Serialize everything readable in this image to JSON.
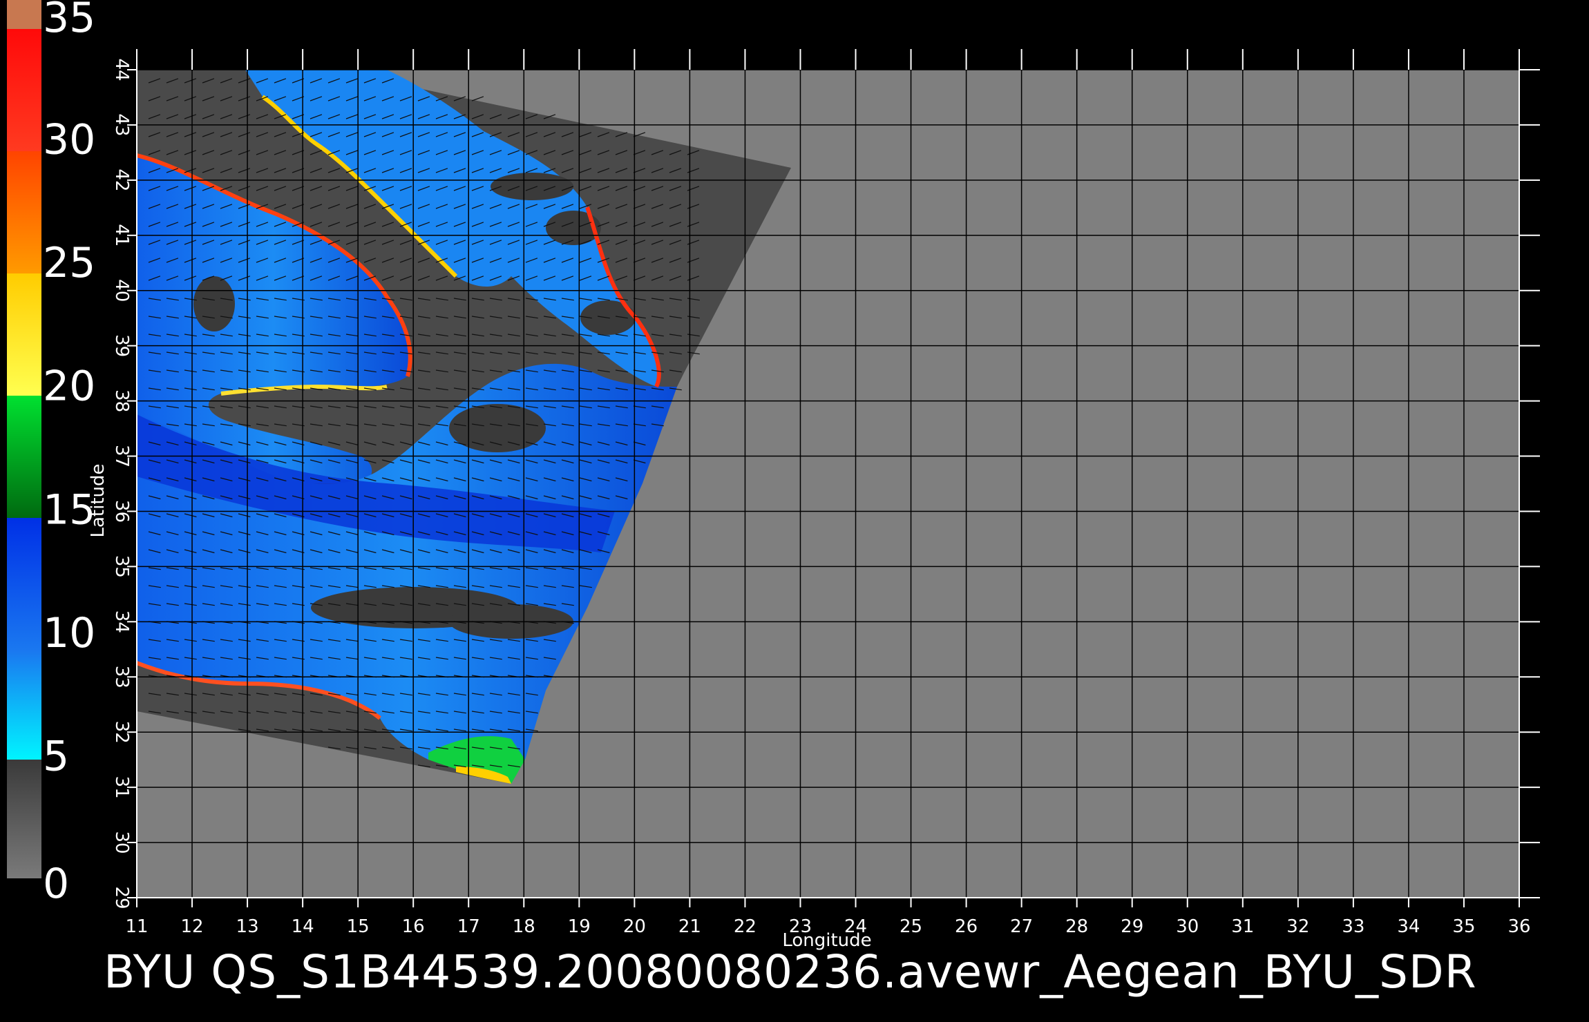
{
  "caption": "BYU  QS_S1B44539.20080080236.avewr_Aegean_BYU_SDR",
  "axes": {
    "xlabel": "Longitude",
    "ylabel": "Latitude",
    "lon_range": [
      11,
      36
    ],
    "lat_range": [
      29,
      44
    ],
    "lon_ticks": [
      "11",
      "12",
      "13",
      "14",
      "15",
      "16",
      "17",
      "18",
      "19",
      "20",
      "21",
      "22",
      "23",
      "24",
      "25",
      "26",
      "27",
      "28",
      "29",
      "30",
      "31",
      "32",
      "33",
      "34",
      "35",
      "36"
    ],
    "lat_ticks": [
      "29",
      "30",
      "31",
      "32",
      "33",
      "34",
      "35",
      "36",
      "37",
      "38",
      "39",
      "40",
      "41",
      "42",
      "43",
      "44"
    ],
    "grid": true
  },
  "colorbar": {
    "labels": [
      "0",
      "5",
      "10",
      "15",
      "20",
      "25",
      "30",
      "35"
    ],
    "values": [
      0,
      5,
      10,
      15,
      20,
      25,
      30,
      35
    ],
    "colors": {
      "0_5": [
        "#7a7a7a",
        "#3c3c3c"
      ],
      "5_15": [
        "#00f0ff",
        "#1060f0",
        "#0030e0"
      ],
      "15_20": [
        "#007a10",
        "#00e030"
      ],
      "20_25": [
        "#ffff40",
        "#ffd000"
      ],
      "25_30": [
        "#ff9a00",
        "#ff4a00"
      ],
      "30_35": [
        "#ff3020",
        "#ff1010"
      ],
      "35_top": [
        "#c87850"
      ]
    }
  },
  "colors": {
    "background": "#000000",
    "ocean_no_data": "#7f7f7f",
    "swath_land": "#4a4a4a",
    "grid_line": "#000000",
    "axis": "#ffffff",
    "calm_wind": "#3a3a3a"
  }
}
